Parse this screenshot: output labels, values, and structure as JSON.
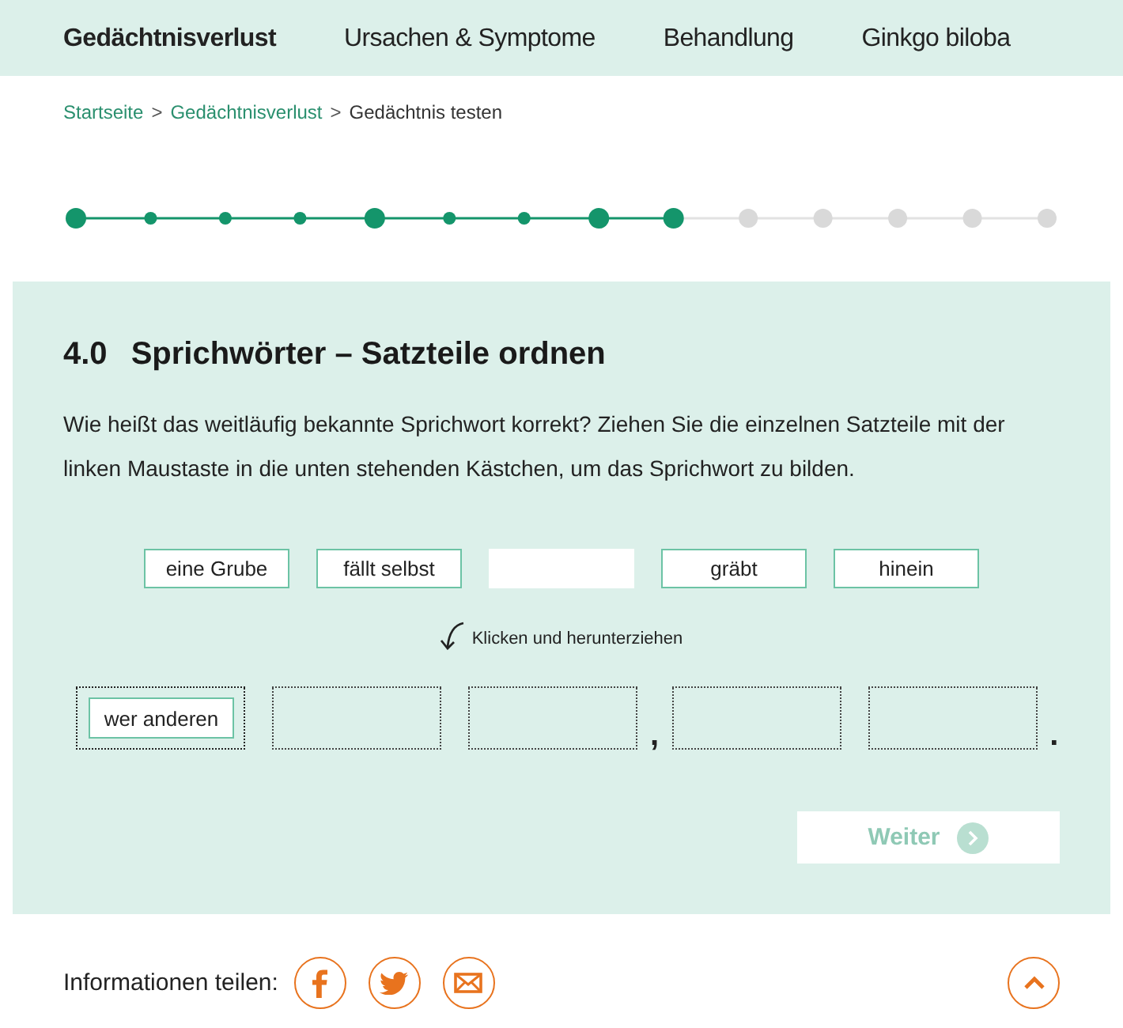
{
  "nav": {
    "items": [
      {
        "label": "Gedächtnisverlust",
        "selected": true
      },
      {
        "label": "Ursachen & Symptome",
        "selected": false
      },
      {
        "label": "Behandlung",
        "selected": false
      },
      {
        "label": "Ginkgo biloba",
        "selected": false
      }
    ]
  },
  "breadcrumb": [
    {
      "kind": "link",
      "text": "Startseite"
    },
    {
      "kind": "separator",
      "text": ">"
    },
    {
      "kind": "link",
      "text": "Gedächtnisverlust"
    },
    {
      "kind": "separator",
      "text": ">"
    },
    {
      "kind": "current",
      "text": "Gedächtnis testen"
    }
  ],
  "progress": {
    "steps": [
      {
        "kind": "major",
        "done": true
      },
      {
        "kind": "minor",
        "done": true
      },
      {
        "kind": "minor",
        "done": true
      },
      {
        "kind": "minor",
        "done": true
      },
      {
        "kind": "major",
        "done": true
      },
      {
        "kind": "minor",
        "done": true
      },
      {
        "kind": "minor",
        "done": true
      },
      {
        "kind": "major",
        "done": true
      },
      {
        "kind": "major",
        "done": true
      },
      {
        "kind": "major",
        "done": false
      },
      {
        "kind": "major",
        "done": false
      },
      {
        "kind": "major",
        "done": false
      },
      {
        "kind": "major",
        "done": false
      },
      {
        "kind": "major",
        "done": false
      }
    ]
  },
  "quiz": {
    "number": "4.0",
    "title": "Sprichwörter – Satzteile ordnen",
    "instructions": "Wie heißt das weitläufig bekannte Sprichwort korrekt? Ziehen Sie die einzelnen Satzteile mit der linken Maustaste in die unten stehenden Kästchen, um das Sprichwort zu bilden.",
    "tiles": [
      {
        "kind": "word",
        "text": "eine Grube"
      },
      {
        "kind": "word",
        "text": "fällt selbst"
      },
      {
        "kind": "vacant"
      },
      {
        "kind": "word",
        "text": "gräbt"
      },
      {
        "kind": "word",
        "text": "hinein"
      }
    ],
    "hint": "Klicken und herunterziehen",
    "slots": [
      {
        "filled": true,
        "text": "wer anderen"
      },
      {
        "filled": false
      },
      {
        "filled": false,
        "punctuation": ","
      },
      {
        "filled": false
      },
      {
        "filled": false,
        "punctuation": "."
      }
    ],
    "next_button": {
      "label": "Weiter",
      "disabled": true
    }
  },
  "share": {
    "label": "Informationen teilen:",
    "buttons": [
      {
        "kind": "facebook"
      },
      {
        "kind": "twitter"
      },
      {
        "kind": "email"
      }
    ]
  }
}
